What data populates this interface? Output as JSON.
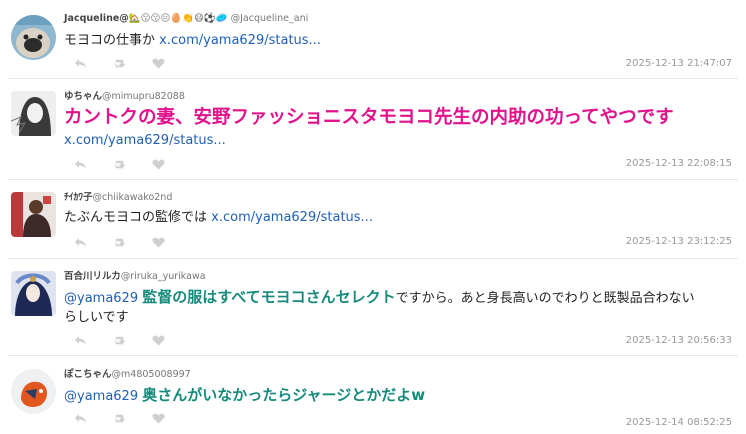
{
  "tweets": [
    {
      "display_name": "Jacqueline@",
      "emojis": "🏡😗😗😐🥚👏😷⚽🥏",
      "handle": "@Jacqueline_ani",
      "text": "モヨコの仕事か",
      "link": "x.com/yama629/status...",
      "timestamp": "2025-12-13 21:47:07"
    },
    {
      "display_name": "ゆちゃん",
      "handle": "@mimupru82088",
      "text": "カントクの妻、安野ファッショニスタモヨコ先生の内助の功ってやつです",
      "link": "x.com/yama629/status...",
      "timestamp": "2025-12-13 22:08:15"
    },
    {
      "display_name": "ﾁｲｶﾜ子",
      "handle": "@chiikawako2nd",
      "text": "たぶんモヨコの監修では",
      "link": "x.com/yama629/status...",
      "timestamp": "2025-12-13 23:12:25"
    },
    {
      "display_name": "百合川リルカ",
      "handle": "@riruka_yurikawa",
      "mention": "@yama629",
      "text_highlight": "監督の服はすべてモヨコさんセレクト",
      "text_rest": "ですから。あと身長高いのでわりと既製品合わない",
      "text_rest2": "らしいです",
      "timestamp": "2025-12-13 20:56:33"
    },
    {
      "display_name": "ぽこちゃん",
      "handle": "@m4805008997",
      "mention": "@yama629",
      "text_highlight": "奥さんがいなかったらジャージとかだよw",
      "timestamp": "2025-12-14 08:52:25"
    }
  ],
  "icons": [
    "reply-icon",
    "retweet-icon",
    "like-icon"
  ],
  "colors": {
    "link": "#1f5fb4",
    "highlight_pink": "#e0128c",
    "highlight_teal": "#168a7b",
    "timestamp": "#999999"
  }
}
